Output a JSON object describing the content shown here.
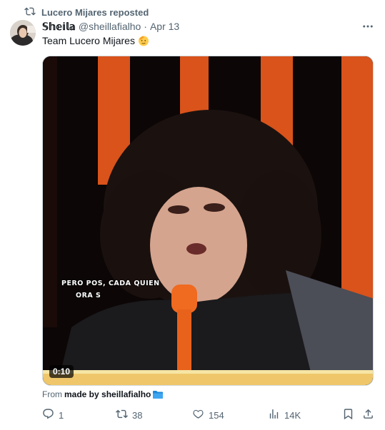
{
  "repost": {
    "label": "Lucero Mijares reposted",
    "icon": "repost-icon"
  },
  "author": {
    "display_name": "𝕊𝕙𝕖𝕚𝕝𝕒",
    "handle": "@sheillafialho",
    "separator": "·",
    "date": "Apr 13",
    "avatar": "avatar"
  },
  "tweet": {
    "text": "Team Lucero Mijares",
    "emoji": "saluting-face-emoji"
  },
  "media": {
    "caption_line1": "PERO POS, CADA QUIEN",
    "caption_line2": "ORA S",
    "duration": "0:10"
  },
  "source": {
    "prefix": "From",
    "name": "made by sheillafialho",
    "icon": "folder-emoji"
  },
  "actions": {
    "reply_count": "1",
    "repost_count": "38",
    "like_count": "154",
    "view_count": "14K"
  },
  "colors": {
    "text": "#0f1419",
    "muted": "#536471",
    "border": "#cfd9de"
  }
}
